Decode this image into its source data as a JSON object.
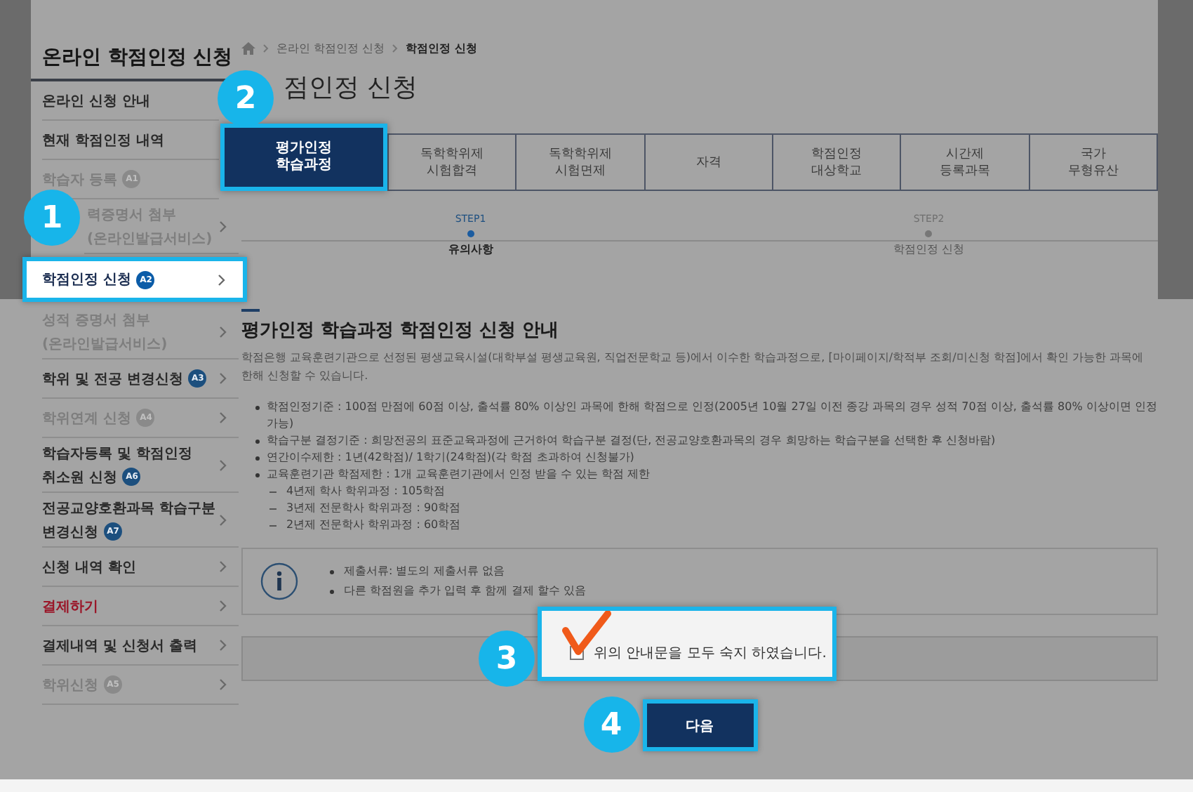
{
  "sidebar": {
    "title": "온라인 학점인정 신청",
    "items": [
      {
        "lines": [
          "온라인 신청 안내"
        ],
        "disabled": false,
        "selected": false,
        "alert": false,
        "arrow": false
      },
      {
        "lines": [
          "현재 학점인정 내역"
        ],
        "disabled": false,
        "selected": false,
        "alert": false,
        "arrow": false
      },
      {
        "lines": [
          "학습자 등록"
        ],
        "badge": "A1",
        "disabled": true,
        "selected": false,
        "alert": false,
        "arrow": false
      },
      {
        "lines": [
          "력증명서 첨부",
          "(온라인발급서비스)"
        ],
        "disabled": true,
        "selected": false,
        "alert": false,
        "arrow": true
      },
      {
        "lines": [
          "학점인정 신청"
        ],
        "badge": "A2",
        "disabled": false,
        "selected": true,
        "alert": false,
        "arrow": true
      },
      {
        "lines": [
          "성적 증명서 첨부",
          "(온라인발급서비스)"
        ],
        "disabled": true,
        "selected": false,
        "alert": false,
        "arrow": true
      },
      {
        "lines": [
          "학위 및 전공 변경신청"
        ],
        "badge": "A3",
        "disabled": false,
        "selected": false,
        "alert": false,
        "arrow": true
      },
      {
        "lines": [
          "학위연계 신청"
        ],
        "badge": "A4",
        "disabled": true,
        "selected": false,
        "alert": false,
        "arrow": true
      },
      {
        "lines": [
          "학습자등록 및 학점인정",
          "취소원 신청"
        ],
        "badge": "A6",
        "disabled": false,
        "selected": false,
        "alert": false,
        "arrow": true
      },
      {
        "lines": [
          "전공교양호환과목 학습구분",
          "변경신청"
        ],
        "badge": "A7",
        "disabled": false,
        "selected": false,
        "alert": false,
        "arrow": true
      },
      {
        "lines": [
          "신청 내역 확인"
        ],
        "disabled": false,
        "selected": false,
        "alert": false,
        "arrow": true
      },
      {
        "lines": [
          "결제하기"
        ],
        "disabled": false,
        "selected": false,
        "alert": true,
        "arrow": true
      },
      {
        "lines": [
          "결제내역 및 신청서 출력"
        ],
        "disabled": false,
        "selected": false,
        "alert": false,
        "arrow": true
      },
      {
        "lines": [
          "학위신청"
        ],
        "badge": "A5",
        "disabled": true,
        "selected": false,
        "alert": false,
        "arrow": true
      }
    ]
  },
  "breadcrumb": [
    "온라인 학점인정 신청",
    "학점인정 신청"
  ],
  "page_title": "점인정 신청",
  "tabs": [
    {
      "lines": [
        "평가인정",
        "학습과정"
      ],
      "selected": true
    },
    {
      "lines": [
        "독학학위제",
        "시험합격"
      ],
      "selected": false
    },
    {
      "lines": [
        "독학학위제",
        "시험면제"
      ],
      "selected": false
    },
    {
      "lines": [
        "자격"
      ],
      "selected": false
    },
    {
      "lines": [
        "학점인정",
        "대상학교"
      ],
      "selected": false
    },
    {
      "lines": [
        "시간제",
        "등록과목"
      ],
      "selected": false
    },
    {
      "lines": [
        "국가",
        "무형유산"
      ],
      "selected": false
    }
  ],
  "steps": [
    {
      "step": "STEP1",
      "label": "유의사항",
      "selected": true
    },
    {
      "step": "STEP2",
      "label": "학점인정 신청",
      "selected": false
    }
  ],
  "section": {
    "heading": "평가인정 학습과정 학점인정 신청 안내",
    "intro": "학점은행 교육훈련기관으로 선정된 평생교육시설(대학부설 평생교육원, 직업전문학교 등)에서 이수한 학습과정으로, [마이페이지/학적부 조회/미신청 학점]에서 확인 가능한 과목에 한해 신청할 수 있습니다.",
    "bullets": [
      {
        "text": "학점인정기준 : 100점 만점에 60점 이상, 출석률 80% 이상인 과목에 한해 학점으로 인정(2005년 10월 27일 이전 종강 과목의 경우 성적 70점 이상, 출석률 80% 이상이면 인정 가능)"
      },
      {
        "text": "학습구분 결정기준 : 희망전공의 표준교육과정에 근거하여 학습구분 결정(단, 전공교양호환과목의 경우 희망하는 학습구분을 선택한 후 신청바람)"
      },
      {
        "text": "연간이수제한 : 1년(42학점)/ 1학기(24학점)(각 학점 초과하여 신청불가)"
      },
      {
        "text": "교육훈련기관 학점제한 : 1개 교육훈련기관에서 인정 받을 수 있는 학점 제한",
        "children": [
          "4년제 학사 학위과정 : 105학점",
          "3년제 전문학사 학위과정 : 90학점",
          "2년제 전문학사 학위과정 : 60학점"
        ]
      }
    ]
  },
  "info": [
    "제출서류: 별도의 제출서류 없음",
    "다른 학점원을 추가 입력 후 함께 결제 할수 있음"
  ],
  "agreement": {
    "label": "위의 안내문을 모두 숙지 하였습니다.",
    "checked": false
  },
  "next_button": "다음",
  "callouts": [
    "1",
    "2",
    "3",
    "4"
  ]
}
